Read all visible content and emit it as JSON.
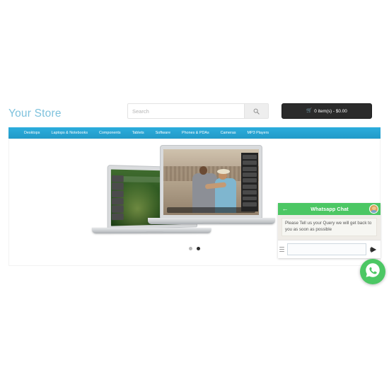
{
  "header": {
    "logo": "Your Store",
    "search": {
      "placeholder": "Search",
      "value": "",
      "button_icon": "search-icon"
    },
    "cart": {
      "icon": "shopping-cart-icon",
      "label": "0 item(s) - $0.00"
    }
  },
  "nav": {
    "items": [
      {
        "label": "Desktops"
      },
      {
        "label": "Laptops & Notebooks"
      },
      {
        "label": "Components"
      },
      {
        "label": "Tablets"
      },
      {
        "label": "Software"
      },
      {
        "label": "Phones & PDAs"
      },
      {
        "label": "Cameras"
      },
      {
        "label": "MP3 Players"
      }
    ]
  },
  "carousel": {
    "slides": [
      {
        "alt": "MacBook Air laptops banner"
      }
    ],
    "dots": [
      {
        "active": false
      },
      {
        "active": true
      }
    ]
  },
  "chat_widget": {
    "back_icon": "back-arrow-icon",
    "title": "Whatsapp Chat",
    "avatar_icon": "agent-avatar-icon",
    "message": "Please Tell us your Query we will get back to you as soon as possible",
    "input": {
      "placeholder": "",
      "value": ""
    },
    "emoji_icon": "emoji-menu-icon",
    "send_icon": "send-arrow-icon"
  },
  "floating_button": {
    "icon": "whatsapp-icon",
    "label": "Whatsapp"
  },
  "colors": {
    "nav_blue": "#229ac8",
    "logo_blue": "#7ec2dd",
    "whatsapp_green": "#4cc764",
    "cart_dark": "#2b2b2b"
  }
}
